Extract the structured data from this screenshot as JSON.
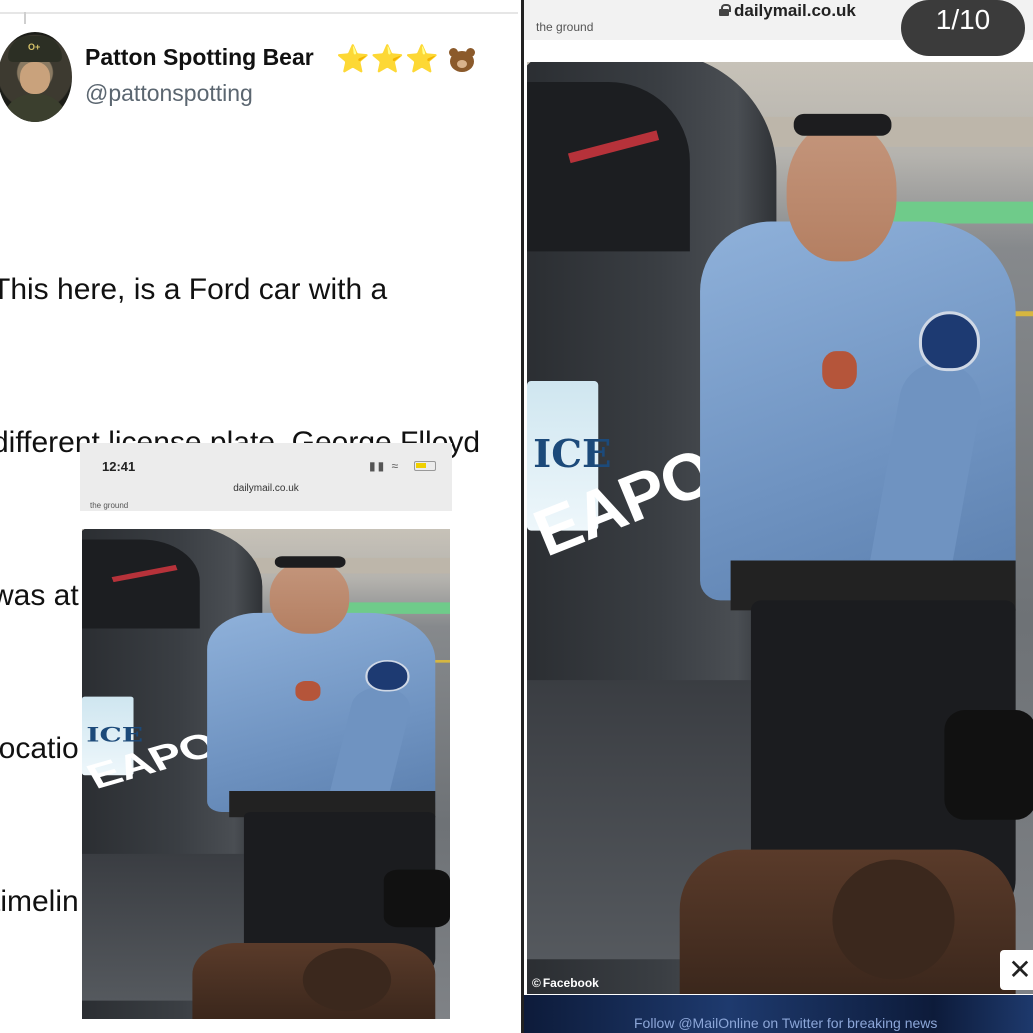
{
  "tweet": {
    "display_name": "Patton Spotting Bear",
    "badges": "⭐⭐⭐",
    "badge_icon": "bear-face-icon",
    "handle": "@pattonspotting",
    "avatar_icon": "profile-avatar",
    "helmet_text": "O+",
    "text_lines": [
      "This here, is a Ford car with a",
      "different license plate. George Flloyd",
      "was at least moved to another",
      "location and a car later on in a",
      "timeline of events."
    ]
  },
  "embedded_screenshot": {
    "status_time": "12:41",
    "status_icons": "signal-wifi-battery",
    "url": "dailymail.co.uk",
    "cutoff_text": "the ground",
    "photo_plate_text": "ICE",
    "photo_decal_text": "EAPOLIS"
  },
  "right_panel": {
    "url": "dailymail.co.uk",
    "cutoff_text": "the ground",
    "image_counter": "1/10",
    "photo_plate_text": "ICE",
    "photo_decal_text": "EAPOLIS",
    "photo_credit": "Facebook",
    "close_symbol": "✕",
    "bottom_banner_text": "Follow @MailOnline on Twitter for breaking news"
  },
  "colors": {
    "star": "#f5c518",
    "counter_bg": "#3b3b3b",
    "uniform_blue": "#6f93c1"
  }
}
